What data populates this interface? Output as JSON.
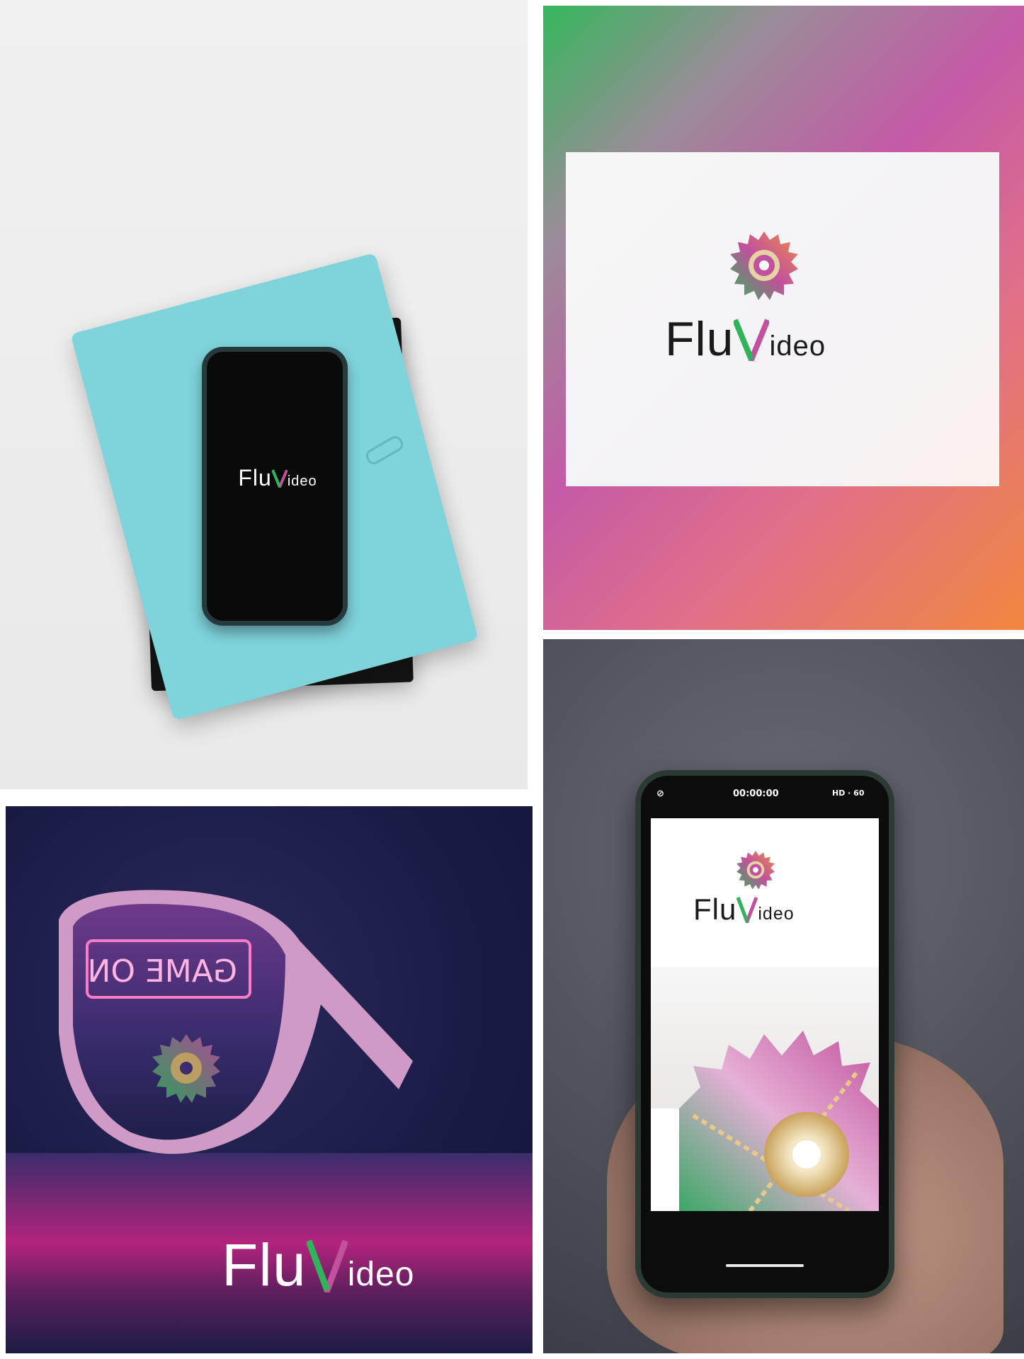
{
  "brand": {
    "wordmark_part1": "Flu",
    "wordmark_part2": "ideo",
    "accent_colors": [
      "#2fb45a",
      "#c1519c",
      "#f1873f",
      "#d9b46a"
    ]
  },
  "panels": {
    "notebook_mockup": {
      "logo_part1": "Flu",
      "logo_part2": "ideo"
    },
    "gradient_card": {
      "logo_part1": "Flu",
      "logo_part2": "ideo"
    },
    "sunglasses": {
      "sign_text": "GAME ON",
      "logo_part1": "Flu",
      "logo_part2": "ideo"
    },
    "phone_camera": {
      "timer": "00:00:00",
      "quality": "HD · 60",
      "logo_part1": "Flu",
      "logo_part2": "ideo"
    }
  }
}
